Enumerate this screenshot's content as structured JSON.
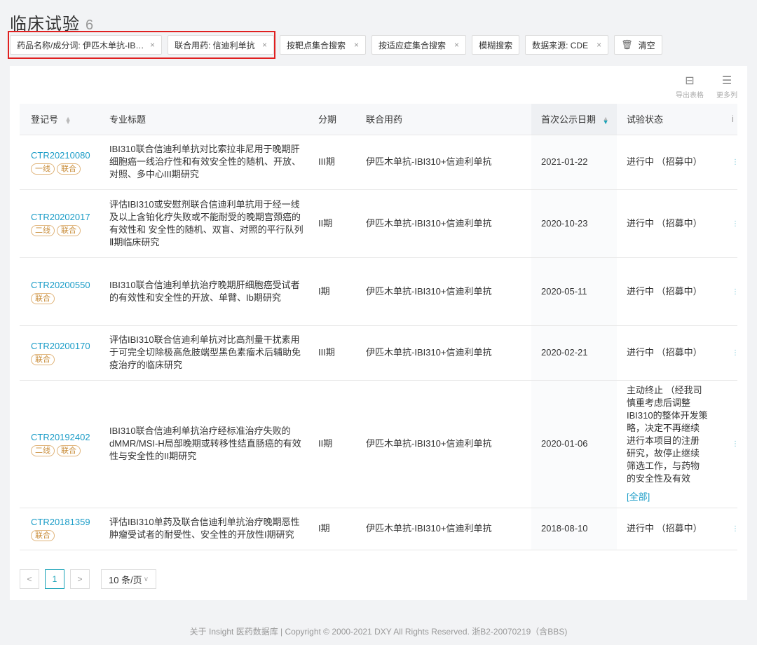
{
  "page": {
    "title": "临床试验",
    "count": "6"
  },
  "filters": [
    {
      "label": "药品名称/成分词: 伊匹木单抗-IB…",
      "close": "×"
    },
    {
      "label": "联合用药: 信迪利单抗",
      "close": "×"
    },
    {
      "label": "按靶点集合搜索",
      "close": "×"
    },
    {
      "label": "按适应症集合搜索",
      "close": "×"
    },
    {
      "label": "模糊搜索"
    },
    {
      "label": "数据来源: CDE",
      "close": "×"
    },
    {
      "label": "清空",
      "icon": "trash-icon"
    }
  ],
  "toolbar": {
    "export_label": "导出表格",
    "more_label": "更多列"
  },
  "table": {
    "headers": [
      "登记号",
      "专业标题",
      "分期",
      "联合用药",
      "首次公示日期",
      "试验状态",
      "i"
    ],
    "rows": [
      {
        "id": "CTR20210080",
        "tags": [
          "一线",
          "联合"
        ],
        "title": "IBI310联合信迪利单抗对比索拉非尼用于晚期肝细胞癌一线治疗性和有效安全性的随机、开放、对照、多中心III期研究",
        "phase": "III期",
        "combo": "伊匹木单抗-IBI310+信迪利单抗",
        "date": "2021-01-22",
        "status": "进行中 （招募中）"
      },
      {
        "id": "CTR20202017",
        "tags": [
          "二线",
          "联合"
        ],
        "title": "评估IBI310或安慰剂联合信迪利单抗用于经一线及以上含铂化疗失败或不能耐受的晚期宫颈癌的有效性和 安全性的随机、双盲、对照的平行队列Ⅱ期临床研究",
        "phase": "II期",
        "combo": "伊匹木单抗-IBI310+信迪利单抗",
        "date": "2020-10-23",
        "status": "进行中 （招募中）"
      },
      {
        "id": "CTR20200550",
        "tags": [
          "联合"
        ],
        "title": "IBI310联合信迪利单抗治疗晚期肝细胞癌受试者的有效性和安全性的开放、单臂、Ib期研究",
        "phase": "I期",
        "combo": "伊匹木单抗-IBI310+信迪利单抗",
        "date": "2020-05-11",
        "status": "进行中 （招募中）"
      },
      {
        "id": "CTR20200170",
        "tags": [
          "联合"
        ],
        "title": "评估IBI310联合信迪利单抗对比高剂量干扰素用于可完全切除极高危肢端型黑色素瘤术后辅助免疫治疗的临床研究",
        "phase": "III期",
        "combo": "伊匹木单抗-IBI310+信迪利单抗",
        "date": "2020-02-21",
        "status": "进行中 （招募中）"
      },
      {
        "id": "CTR20192402",
        "tags": [
          "二线",
          "联合"
        ],
        "title": "IBI310联合信迪利单抗治疗经标准治疗失败的dMMR/MSI-H局部晚期或转移性结直肠癌的有效性与安全性的II期研究",
        "phase": "II期",
        "combo": "伊匹木单抗-IBI310+信迪利单抗",
        "date": "2020-01-06",
        "status": "主动终止 （经我司慎重考虑后调整IBI310的整体开发策略，决定不再继续进行本项目的注册研究，故停止继续筛选工作，与药物的安全性及有效",
        "status_more": "[全部]"
      },
      {
        "id": "CTR20181359",
        "tags": [
          "联合"
        ],
        "title": "评估IBI310单药及联合信迪利单抗治疗晚期恶性肿瘤受试者的耐受性、安全性的开放性I期研究",
        "phase": "I期",
        "combo": "伊匹木单抗-IBI310+信迪利单抗",
        "date": "2018-08-10",
        "status": "进行中 （招募中）"
      }
    ]
  },
  "pagination": {
    "prev": "<",
    "current": "1",
    "next": ">",
    "page_size": "10 条/页"
  },
  "footer": "关于 Insight 医药数据库 | Copyright © 2000-2021 DXY All Rights Reserved. 浙B2-20070219（含BBS)"
}
